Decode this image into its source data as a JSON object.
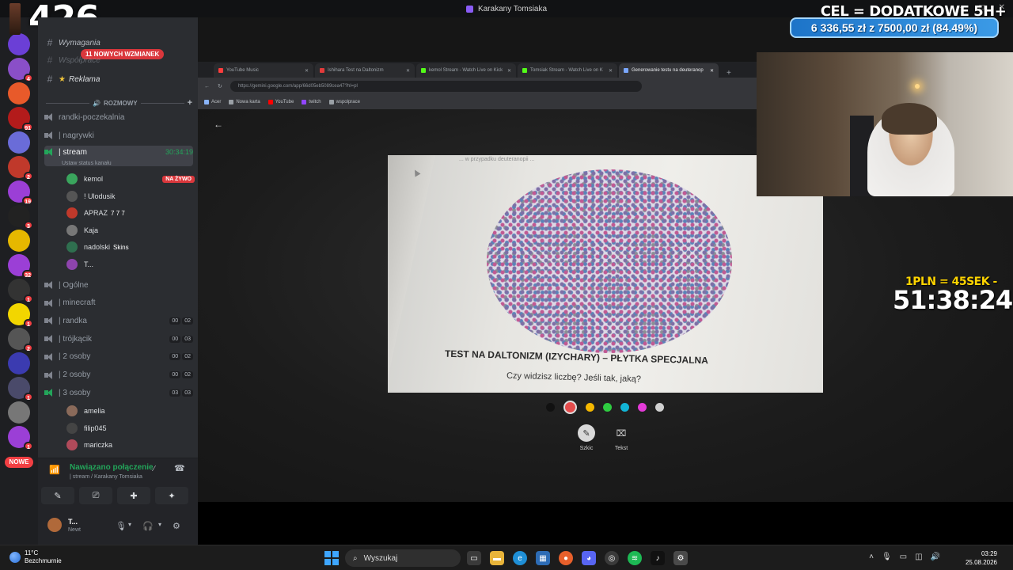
{
  "window": {
    "title": "Karakany Tomsiaka"
  },
  "overlay": {
    "counter": "426",
    "goal_title": "CEL = DODATKOWE 5H+",
    "goal_progress": "6 336,55 zł z 7500,00 zł (84.49%)",
    "goal_fraction": 0.8449,
    "subathon_rate": "1PLN = 45SEK -",
    "subathon_time": "51:38:24"
  },
  "rail": {
    "new_label": "NOWE",
    "servers": [
      {
        "badge": ""
      },
      {
        "badge": "4"
      },
      {
        "badge": ""
      },
      {
        "badge": "91"
      },
      {
        "badge": ""
      },
      {
        "badge": "2"
      },
      {
        "badge": "19"
      },
      {
        "badge": "3"
      },
      {
        "badge": ""
      },
      {
        "badge": "32"
      },
      {
        "badge": "1"
      },
      {
        "badge": "1"
      },
      {
        "badge": "2"
      },
      {
        "badge": ""
      },
      {
        "badge": "1"
      },
      {
        "badge": ""
      },
      {
        "badge": "1"
      }
    ]
  },
  "sidebar": {
    "mentions": "11 NOWYCH WZMIANEK",
    "channels_top": [
      {
        "label": "Wymagania"
      },
      {
        "label": "Współprace"
      },
      {
        "label": "Reklama"
      }
    ],
    "category": "ROZMOWY",
    "voice_channels_a": [
      {
        "label": "randki-poczekalnia"
      },
      {
        "label": "| nagrywki"
      }
    ],
    "active_channel": {
      "label": "| stream",
      "timer": "30:34:19",
      "status": "Ustaw status kanału"
    },
    "users": [
      {
        "name": "kemol",
        "tag": "",
        "live": "NA ŻYWO"
      },
      {
        "name": "! Ulodusik",
        "tag": ""
      },
      {
        "name": "APRAZ",
        "tag": "7 7 7"
      },
      {
        "name": "Kaja",
        "tag": ""
      },
      {
        "name": "nadolski",
        "tag": "Skins"
      },
      {
        "name": "T...",
        "tag": ""
      }
    ],
    "voice_channels_b": [
      {
        "label": "| Ogólne",
        "c1": "",
        "c2": ""
      },
      {
        "label": "| minecraft",
        "c1": "",
        "c2": ""
      },
      {
        "label": "| randka",
        "c1": "00",
        "c2": "02"
      },
      {
        "label": "| trójkącik",
        "c1": "00",
        "c2": "03"
      },
      {
        "label": "| 2 osoby",
        "c1": "00",
        "c2": "02"
      },
      {
        "label": "| 2 osoby",
        "c1": "00",
        "c2": "02"
      },
      {
        "label": "| 3 osoby",
        "c1": "03",
        "c2": "03"
      }
    ],
    "bottom_users": [
      {
        "name": "amelia"
      },
      {
        "name": "filip045"
      },
      {
        "name": "mariczka"
      }
    ],
    "voice_panel": {
      "title": "Nawiązano połączenie",
      "subtitle": "| stream / Karakany Tomsiaka"
    },
    "userbar": {
      "name": "T...",
      "status": "Newt"
    }
  },
  "browser": {
    "tabs": [
      {
        "label": "YouTube Music",
        "color": "#ff3d3d"
      },
      {
        "label": "Ishihara Test na Daltonizm",
        "color": "#e33b3b"
      },
      {
        "label": "kemol Stream - Watch Live on Kick",
        "color": "#53fc18"
      },
      {
        "label": "Tomsiak Stream - Watch Live on K",
        "color": "#53fc18"
      },
      {
        "label": "Generowanie testu na deuteranop",
        "color": "#7aa7ff"
      }
    ],
    "url": "https://gemini.google.com/app/66d05eb5089cea47?hl=pl",
    "bookmarks": [
      {
        "label": "Acer",
        "color": "#8ab4f8"
      },
      {
        "label": "Nowa karta",
        "color": "#9aa0a6"
      },
      {
        "label": "YouTube",
        "color": "#ff0000"
      },
      {
        "label": "twitch",
        "color": "#9146ff"
      },
      {
        "label": "wspolprace",
        "color": "#9aa0a6"
      }
    ]
  },
  "viewer": {
    "plate_title": "TEST NA DALTONIZM (IZYCHARY) – PŁYTKA SPECJALNA",
    "plate_question": "Czy widzisz liczbę? Jeśli tak, jaką?",
    "top_caption": "... w przypadku deuteranopii ...",
    "palette": [
      "#111111",
      "#e44c4c",
      "#f5b800",
      "#2ecc40",
      "#12b5d6",
      "#e43ad8",
      "#d0d0d0"
    ],
    "tools": [
      {
        "label": "Szkic"
      },
      {
        "label": "Tekst"
      }
    ]
  },
  "taskbar": {
    "temp": "11°C",
    "weather": "Bezchmurnie",
    "search_placeholder": "Wyszukaj",
    "time": "03:29",
    "date": "25.08.2026"
  }
}
